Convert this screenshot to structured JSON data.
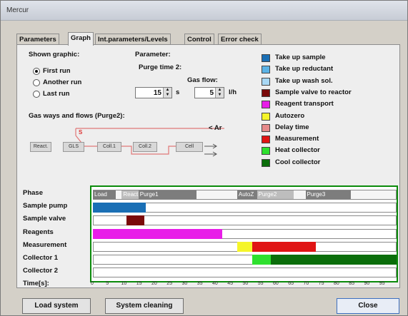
{
  "window": {
    "title": "Mercur"
  },
  "tabs": [
    {
      "label": "Parameters"
    },
    {
      "label": "Graph"
    },
    {
      "label": "Int.parameters/Levels"
    },
    {
      "label": "Control"
    },
    {
      "label": "Error check"
    }
  ],
  "shown_graphic": {
    "label": "Shown graphic:",
    "options": [
      {
        "label": "First run",
        "selected": true
      },
      {
        "label": "Another run",
        "selected": false
      },
      {
        "label": "Last run",
        "selected": false
      }
    ]
  },
  "parameter": {
    "label": "Parameter:",
    "purge_label": "Purge time 2:",
    "gas_flow_label": "Gas flow:",
    "purge_value": "15",
    "purge_unit": "s",
    "gas_value": "5",
    "gas_unit": "l/h"
  },
  "flow_diagram": {
    "label": "Gas ways and flows (Purge2):",
    "argon_label": "< Ar",
    "marker": "S",
    "boxes": [
      "React.",
      "GLS",
      "Coll.1",
      "Coll.2",
      "Cell"
    ]
  },
  "legend": [
    {
      "label": "Take up sample",
      "color": "#1a6fb5"
    },
    {
      "label": "Take up reductant",
      "color": "#5bb3e6"
    },
    {
      "label": "Take up wash sol.",
      "color": "#a8d8f5"
    },
    {
      "label": "Sample valve to reactor",
      "color": "#7a0a0a"
    },
    {
      "label": "Reagent transport",
      "color": "#e81ee8"
    },
    {
      "label": "Autozero",
      "color": "#f5f52a"
    },
    {
      "label": "Delay time",
      "color": "#e68a8a"
    },
    {
      "label": "Measurement",
      "color": "#e01414"
    },
    {
      "label": "Heat collector",
      "color": "#2ee02e"
    },
    {
      "label": "Cool collector",
      "color": "#0b6e0b"
    }
  ],
  "gantt": {
    "rows": [
      "Phase",
      "Sample pump",
      "Sample valve",
      "Reagents",
      "Measurement",
      "Collector 1",
      "Collector 2"
    ],
    "time_label": "Time[s]:",
    "ticks": [
      "0",
      "5",
      "10",
      "15",
      "20",
      "25",
      "30",
      "35",
      "40",
      "45",
      "50",
      "55",
      "60",
      "65",
      "70",
      "75",
      "80",
      "85",
      "90",
      "95"
    ],
    "max_time": 100,
    "phases": [
      {
        "label": "Load",
        "start": 0,
        "end": 7.5,
        "shade": "dark"
      },
      {
        "label": "React",
        "start": 9.5,
        "end": 15,
        "shade": "light"
      },
      {
        "label": "Purge1",
        "start": 15,
        "end": 34,
        "shade": "dark"
      },
      {
        "label": "AutoZ",
        "start": 47.5,
        "end": 54,
        "shade": "dark"
      },
      {
        "label": "Purge2",
        "start": 54,
        "end": 66,
        "shade": "light"
      },
      {
        "label": "Purge3",
        "start": 70,
        "end": 85,
        "shade": "dark"
      }
    ],
    "bars": [
      {
        "row": 1,
        "start": 0,
        "end": 17.5,
        "color": "#1a6fb5"
      },
      {
        "row": 2,
        "start": 11,
        "end": 17,
        "color": "#7a0a0a"
      },
      {
        "row": 3,
        "start": 0,
        "end": 42.5,
        "color": "#e81ee8"
      },
      {
        "row": 4,
        "start": 47.5,
        "end": 52.5,
        "color": "#f5f52a"
      },
      {
        "row": 4,
        "start": 52.5,
        "end": 73.5,
        "color": "#e01414"
      },
      {
        "row": 5,
        "start": 52.5,
        "end": 58.5,
        "color": "#2ee02e"
      },
      {
        "row": 5,
        "start": 58.5,
        "end": 100,
        "color": "#0b6e0b"
      }
    ]
  },
  "buttons": {
    "load": "Load system",
    "cleaning": "System cleaning",
    "close": "Close"
  }
}
